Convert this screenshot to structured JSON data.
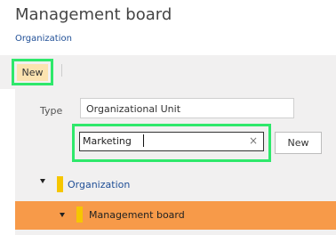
{
  "header": {
    "title": "Management board",
    "breadcrumb": "Organization"
  },
  "toolbar": {
    "new_label": "New"
  },
  "form": {
    "type_label": "Type",
    "type_value": "Organizational Unit",
    "search_value": "Marketing",
    "clear_icon": "×",
    "new_label": "New"
  },
  "tree": {
    "items": [
      {
        "label": "Organization",
        "color": "#f6c600"
      },
      {
        "label": "Management board",
        "color": "#f6c600",
        "selected": true
      }
    ]
  },
  "colors": {
    "highlight_green": "#2ee86b",
    "selected_row": "#f79a49",
    "new_button_bg": "#fce3b0",
    "link_blue": "#1f4e96"
  }
}
